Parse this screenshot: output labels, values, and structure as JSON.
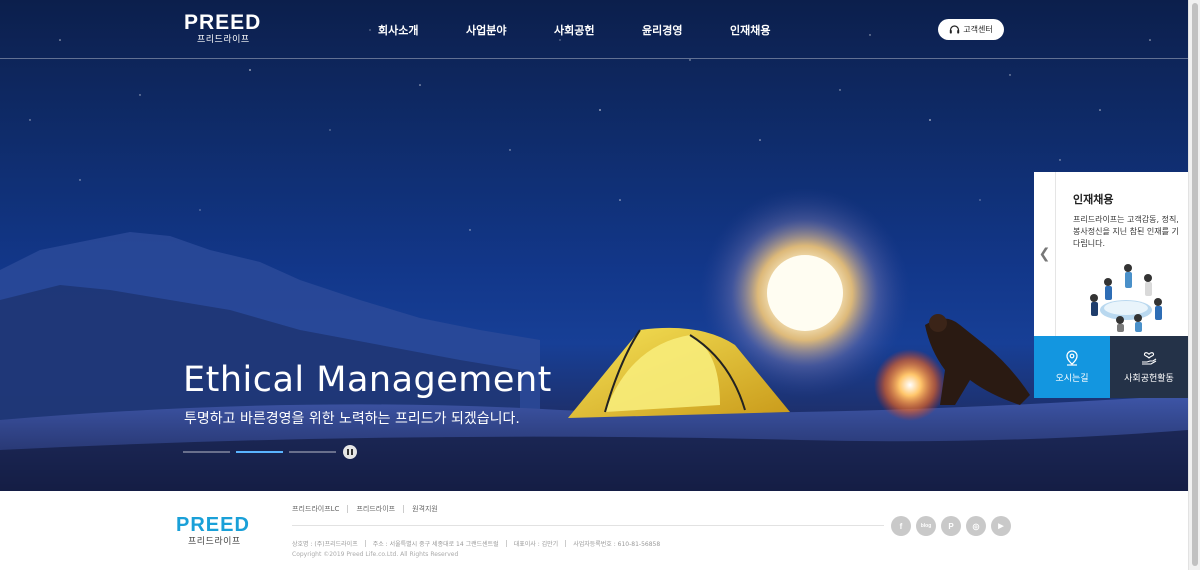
{
  "header": {
    "logo_main": "PREED",
    "logo_sub": "프리드라이프",
    "nav": [
      {
        "label": "회사소개"
      },
      {
        "label": "사업분야"
      },
      {
        "label": "사회공헌"
      },
      {
        "label": "윤리경영"
      },
      {
        "label": "인재채용"
      }
    ],
    "customer_center_label": "고객센터"
  },
  "hero": {
    "title": "Ethical Management",
    "subtitle": "투명하고 바른경영을 위한 노력하는 프리드가 되겠습니다.",
    "slide_count": 3,
    "active_slide": 2
  },
  "side_panel": {
    "title": "인재채용",
    "description": "프리드라이프는 고객감동, 정직, 봉사정신을 지닌 참된 인재를 기다립니다.",
    "buttons": [
      {
        "label": "오시는길",
        "icon": "location-pin-icon"
      },
      {
        "label": "사회공헌활동",
        "icon": "heart-hand-icon"
      }
    ]
  },
  "footer": {
    "logo_main": "PREED",
    "logo_sub": "프리드라이프",
    "links": [
      "프리드라이프LC",
      "프리드라이프",
      "원격지원"
    ],
    "info": [
      "상호명 : (주)프리드라이프",
      "주소 : 서울특별시 중구 세종대로 14 그랜드센트럴",
      "대표이사 : 김만기",
      "사업자등록번호 : 610-81-56858"
    ],
    "copyright": "Copyright ©2019 Preed Life.co.Ltd. All Rights Reserved",
    "social": [
      {
        "name": "facebook-icon",
        "glyph": "f"
      },
      {
        "name": "blog-icon",
        "glyph": "blog"
      },
      {
        "name": "post-icon",
        "glyph": "P"
      },
      {
        "name": "instagram-icon",
        "glyph": "◎"
      },
      {
        "name": "youtube-icon",
        "glyph": "▶"
      }
    ]
  },
  "colors": {
    "accent_blue": "#1396e0",
    "dark_button": "#243248",
    "footer_logo": "#1aa0d8",
    "indicator_active": "#5ab4ff"
  }
}
